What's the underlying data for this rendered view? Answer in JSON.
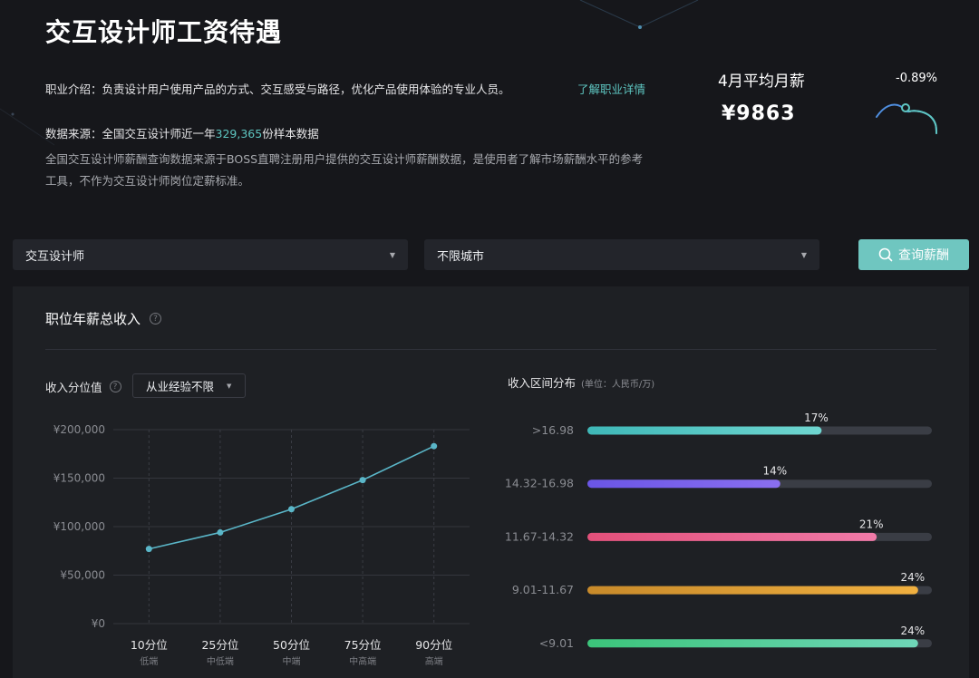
{
  "header": {
    "title": "交互设计师工资待遇",
    "intro": "职业介绍：负责设计用户使用产品的方式、交互感受与路径，优化产品使用体验的专业人员。",
    "intro_link": "了解职业详情",
    "source_prefix": "数据来源：全国交互设计师近一年",
    "source_count": "329,365",
    "source_suffix": "份样本数据",
    "description": "全国交互设计师薪酬查询数据来源于BOSS直聘注册用户提供的交互设计师薪酬数据，是使用者了解市场薪酬水平的参考工具，不作为交互设计师岗位定薪标准。"
  },
  "summary": {
    "avg_label": "4月平均月薪",
    "avg_value": "¥9863",
    "change": "-0.89%",
    "trend_icon": "trend-line-icon"
  },
  "filters": {
    "job": "交互设计师",
    "city": "不限城市",
    "query_label": "查询薪酬",
    "query_icon": "search-icon"
  },
  "panel": {
    "title": "职位年薪总收入",
    "help_icon": "question-circle-icon",
    "percentile_label": "收入分位值",
    "experience": "从业经验不限",
    "distribution_label": "收入区间分布",
    "distribution_unit": "(单位：人民币/万)"
  },
  "chart_data": [
    {
      "type": "line",
      "categories": [
        "10分位",
        "25分位",
        "50分位",
        "75分位",
        "90分位"
      ],
      "sub_categories": [
        "低端",
        "中低端",
        "中端",
        "中高端",
        "高端"
      ],
      "values": [
        77000,
        94000,
        118000,
        148000,
        183000
      ],
      "y_ticks": [
        "¥200,000",
        "¥150,000",
        "¥100,000",
        "¥50,000",
        "¥0"
      ],
      "ylim": [
        0,
        200000
      ],
      "grid": true,
      "color": "#5ab6c8"
    },
    {
      "type": "bar",
      "orientation": "horizontal",
      "categories": [
        ">16.98",
        "14.32-16.98",
        "11.67-14.32",
        "9.01-11.67",
        "<9.01"
      ],
      "values": [
        17,
        14,
        21,
        24,
        24
      ],
      "labels": [
        "17%",
        "14%",
        "21%",
        "24%",
        "24%"
      ],
      "fill_fraction": [
        0.68,
        0.56,
        0.84,
        0.96,
        0.96
      ],
      "colors": [
        [
          "#3fb8b8",
          "#6fd6d0"
        ],
        [
          "#6a55e6",
          "#8a6ff0"
        ],
        [
          "#e3507a",
          "#f07aa8"
        ],
        [
          "#c88a2a",
          "#f0b040"
        ],
        [
          "#3bc47a",
          "#6fd6b8"
        ]
      ],
      "track_color": "#3a3d45"
    }
  ]
}
